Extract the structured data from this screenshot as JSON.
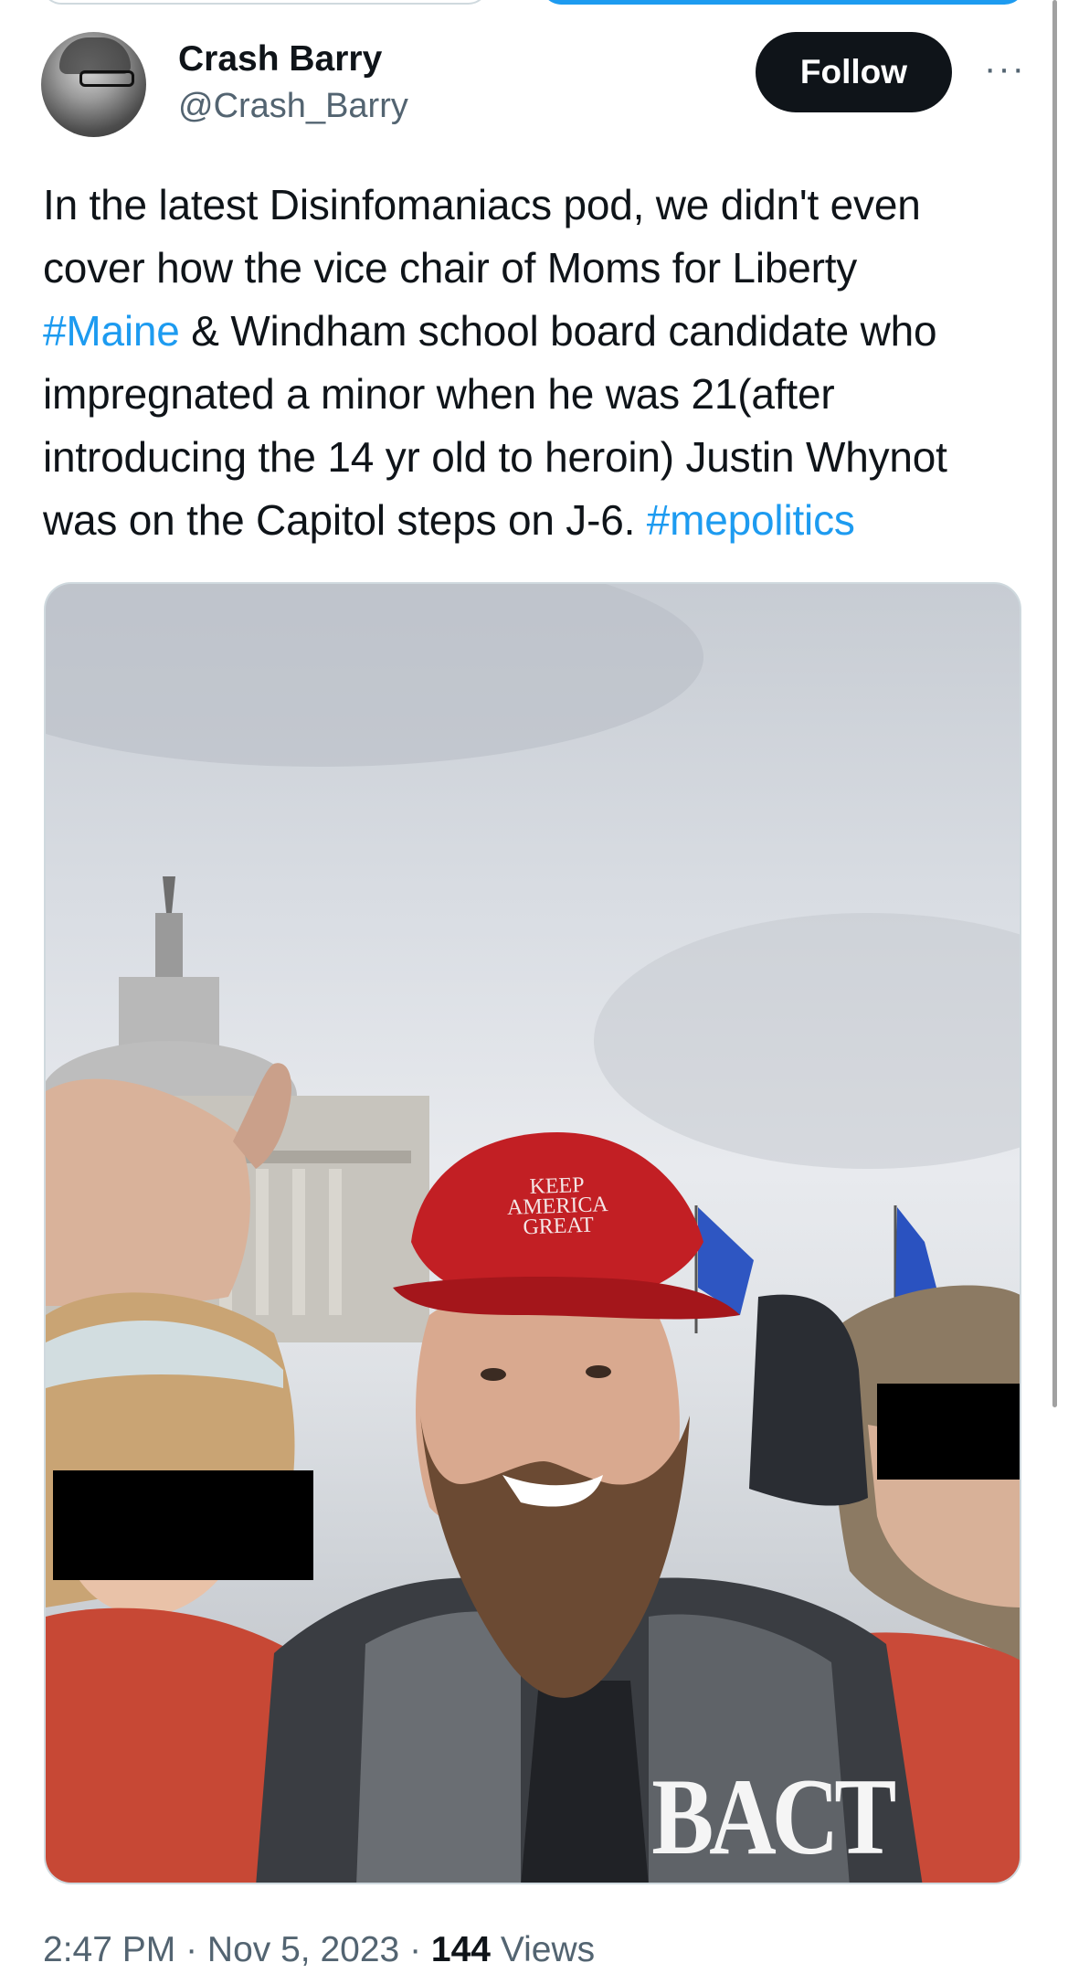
{
  "author": {
    "name": "Crash Barry",
    "handle": "@Crash_Barry"
  },
  "actions": {
    "follow_label": "Follow",
    "more_label": "···"
  },
  "tweet": {
    "lines": [
      "In the latest Disinfomaniacs pod, we didn't even",
      "cover how the vice chair of Moms for Liberty",
      "impregnated a minor when he was 21(after",
      "introducing the 14 yr old to heroin) Justin Whynot",
      "was on the Capitol steps on J-6."
    ],
    "hashtag_maine": "#Maine",
    "line3_rest": " & Windham school board candidate who",
    "hashtag_mepolitics": "#mepolitics"
  },
  "media": {
    "hat_text_1": "KEEP",
    "hat_text_2": "AMERICA",
    "hat_text_3": "GREAT",
    "shirt_text": "BACT"
  },
  "meta": {
    "time": "2:47 PM",
    "separator": " · ",
    "date": "Nov 5, 2023",
    "views_count": "144",
    "views_label": " Views"
  }
}
